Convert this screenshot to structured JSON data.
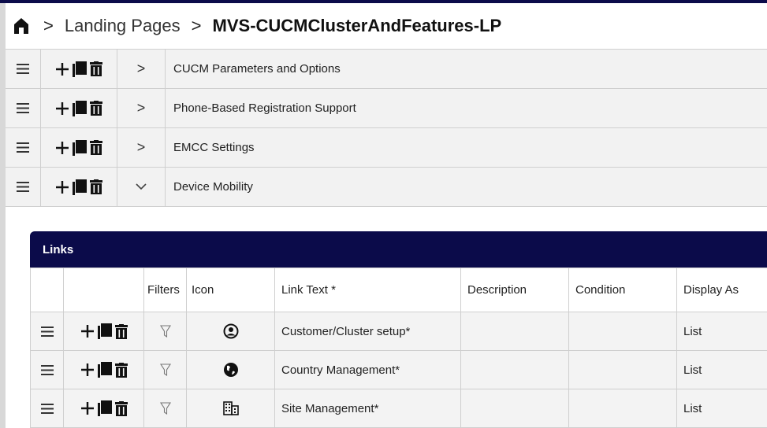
{
  "breadcrumb": {
    "home_icon": "home-icon",
    "separator": ">",
    "items": [
      "Landing Pages",
      "MVS-CUCMClusterAndFeatures-LP"
    ]
  },
  "sections": [
    {
      "title": "CUCM Parameters and Options",
      "chevron": ">",
      "expanded": false
    },
    {
      "title": "Phone-Based Registration Support",
      "chevron": ">",
      "expanded": false
    },
    {
      "title": "EMCC Settings",
      "chevron": ">",
      "expanded": false
    },
    {
      "title": "Device Mobility",
      "chevron": "⌄",
      "expanded": true
    }
  ],
  "links": {
    "title": "Links",
    "columns": [
      "",
      "",
      "Filters",
      "Icon",
      "Link Text *",
      "Description",
      "Condition",
      "Display As"
    ],
    "rows": [
      {
        "icon": "user-circle-icon",
        "link_text": "Customer/Cluster setup*",
        "description": "",
        "condition": "",
        "display_as": "List"
      },
      {
        "icon": "globe-icon",
        "link_text": "Country Management*",
        "description": "",
        "condition": "",
        "display_as": "List"
      },
      {
        "icon": "building-icon",
        "link_text": "Site Management*",
        "description": "",
        "condition": "",
        "display_as": "List"
      }
    ]
  },
  "colors": {
    "header_navy": "#0b0b4a",
    "row_bg": "#f2f2f2",
    "border": "#cfcfcf"
  }
}
